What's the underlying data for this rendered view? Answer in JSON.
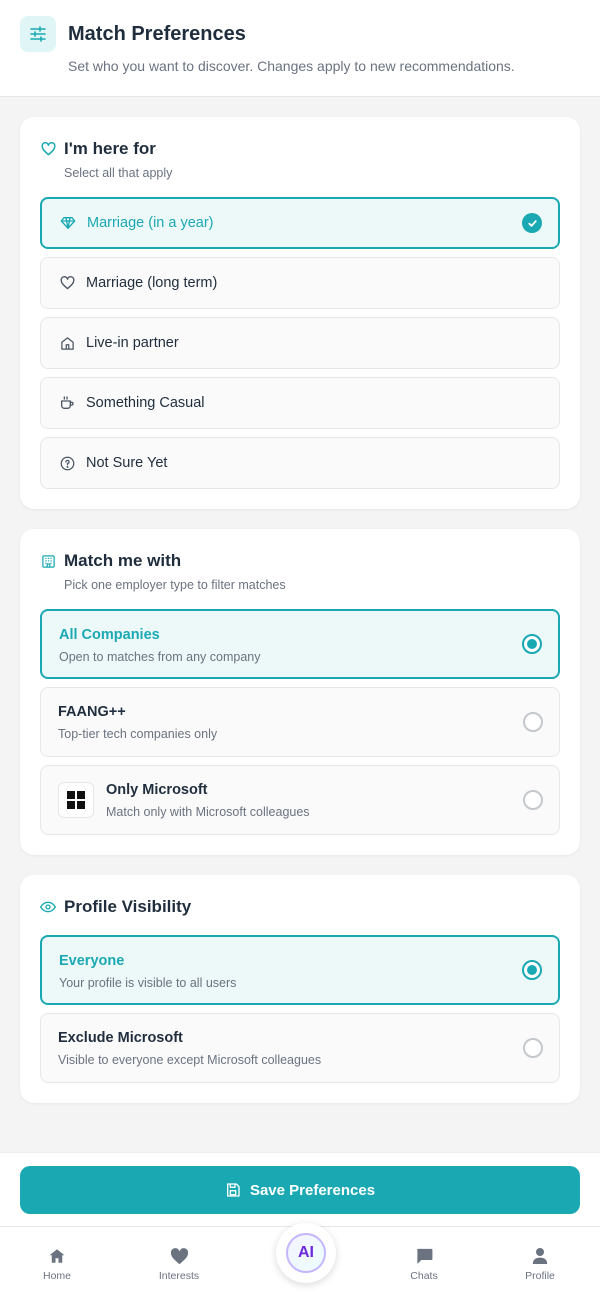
{
  "header": {
    "title": "Match Preferences",
    "subtitle": "Set who you want to discover. Changes apply to new recommendations.",
    "icon": "sliders-icon"
  },
  "intent": {
    "title": "I'm here for",
    "subtitle": "Select all that apply",
    "icon": "heart-icon",
    "options": [
      {
        "label": "Marriage (in a year)",
        "icon": "diamond-icon",
        "selected": true
      },
      {
        "label": "Marriage (long term)",
        "icon": "heart-icon",
        "selected": false
      },
      {
        "label": "Live-in partner",
        "icon": "home-icon",
        "selected": false
      },
      {
        "label": "Something Casual",
        "icon": "coffee-icon",
        "selected": false
      },
      {
        "label": "Not Sure Yet",
        "icon": "question-icon",
        "selected": false
      }
    ]
  },
  "match": {
    "title": "Match me with",
    "subtitle": "Pick one employer type to filter matches",
    "icon": "building-icon",
    "options": [
      {
        "title": "All Companies",
        "subtitle": "Open to matches from any company",
        "selected": true
      },
      {
        "title": "FAANG++",
        "subtitle": "Top-tier tech companies only",
        "selected": false
      },
      {
        "title": "Only Microsoft",
        "subtitle": "Match only with Microsoft colleagues",
        "selected": false,
        "icon": "microsoft-logo-icon"
      }
    ]
  },
  "visibility": {
    "title": "Profile Visibility",
    "icon": "eye-icon",
    "options": [
      {
        "title": "Everyone",
        "subtitle": "Your profile is visible to all users",
        "selected": true
      },
      {
        "title": "Exclude Microsoft",
        "subtitle": "Visible to everyone except Microsoft colleagues",
        "selected": false
      }
    ]
  },
  "save": {
    "label": "Save Preferences",
    "icon": "save-icon"
  },
  "nav": {
    "items": [
      {
        "label": "Home",
        "icon": "home-icon"
      },
      {
        "label": "Interests",
        "icon": "heart-icon"
      },
      {
        "label": "AI",
        "icon": "ai-brain-icon"
      },
      {
        "label": "Chats",
        "icon": "chat-icon"
      },
      {
        "label": "Profile",
        "icon": "person-icon"
      }
    ]
  },
  "colors": {
    "accent": "#1aa9b3",
    "selected_bg": "#edf8f8",
    "page_bg": "#f4f4f5"
  }
}
